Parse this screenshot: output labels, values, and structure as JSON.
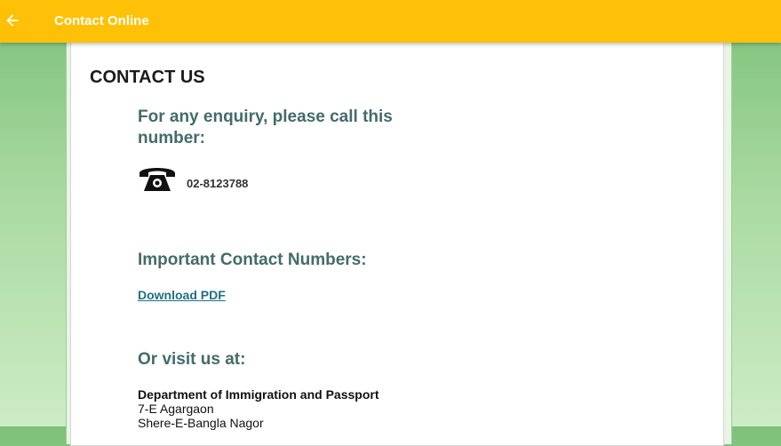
{
  "appbar": {
    "title": "Contact Online",
    "background": "#ffc107",
    "back_icon": "arrow-left-icon"
  },
  "content": {
    "heading": "CONTACT US",
    "enquiry": {
      "line1": "For any enquiry, please call this",
      "line2": "number:",
      "phone_icon": "telephone-icon",
      "phone_number": "02-8123788"
    },
    "important": {
      "title": "Important Contact Numbers:",
      "link_label": "Download PDF"
    },
    "visit": {
      "title": "Or visit us at:",
      "org": "Department of Immigration and Passport",
      "address_line1": "7-E Agargaon",
      "address_line2": "Shere-E-Bangla Nagor"
    }
  }
}
